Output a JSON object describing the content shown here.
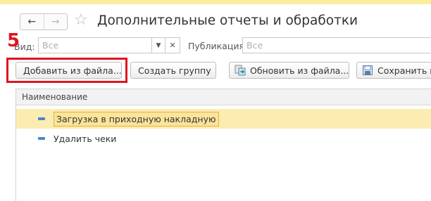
{
  "window": {
    "title": "Дополнительные отчеты и обработки"
  },
  "nav": {
    "back_icon": "arrow-left",
    "forward_icon": "arrow-right",
    "favorite_icon": "star-outline"
  },
  "filters": {
    "kind_label": "Вид:",
    "kind_value": "Все",
    "publication_label": "Публикация:",
    "publication_value": "Все"
  },
  "toolbar": {
    "add_from_file": "Добавить из файла...",
    "create_group": "Создать группу",
    "update_from_file": "Обновить из файла...",
    "save_to": "Сохранить к"
  },
  "annotation": {
    "step_number": "5",
    "color": "#e0141e"
  },
  "table": {
    "columns": [
      "Наименование"
    ],
    "rows": [
      {
        "name": "Загрузка в приходную накладную",
        "selected": true
      },
      {
        "name": "Удалить чеки",
        "selected": false
      }
    ]
  },
  "colors": {
    "selection": "#fbecb1",
    "active_cell": "#fbe49b",
    "accent": "#4d86c8",
    "top_band": "#fbed9e"
  }
}
